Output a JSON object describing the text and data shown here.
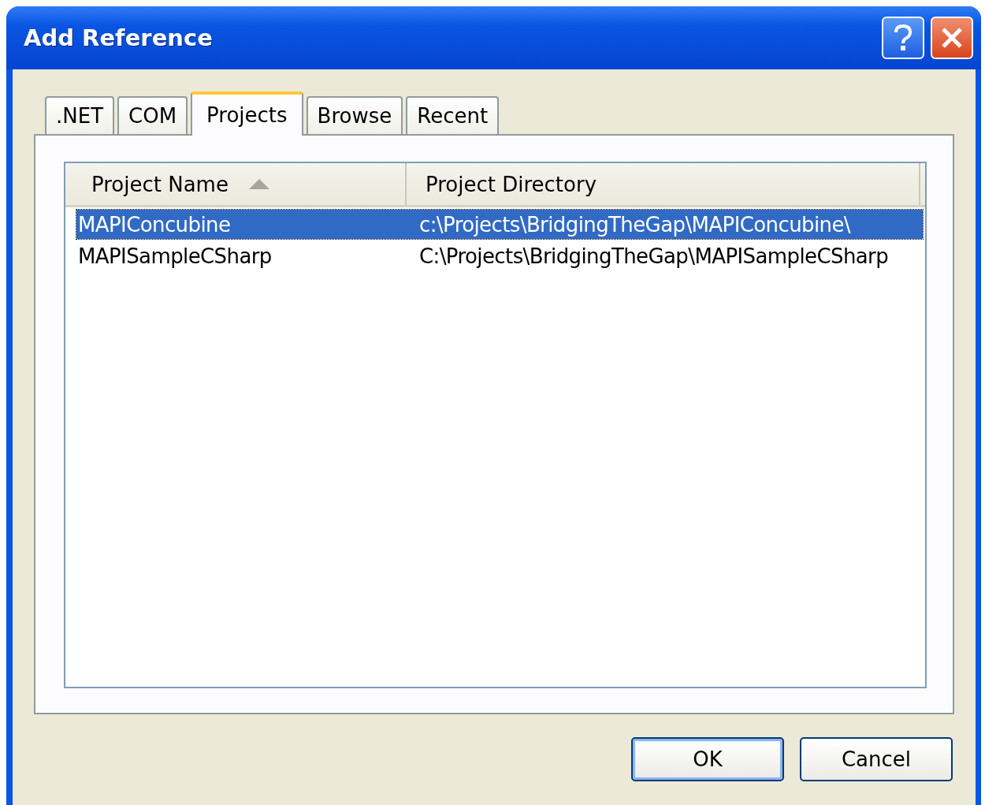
{
  "window": {
    "title": "Add Reference"
  },
  "tabs": [
    {
      "label": ".NET",
      "selected": false
    },
    {
      "label": "COM",
      "selected": false
    },
    {
      "label": "Projects",
      "selected": true
    },
    {
      "label": "Browse",
      "selected": false
    },
    {
      "label": "Recent",
      "selected": false
    }
  ],
  "table": {
    "columns": [
      {
        "label": "Project Name",
        "sorted": true
      },
      {
        "label": "Project Directory",
        "sorted": false
      }
    ],
    "rows": [
      {
        "cells": [
          "MAPIConcubine",
          "c:\\Projects\\BridgingTheGap\\MAPIConcubine\\"
        ],
        "selected": true
      },
      {
        "cells": [
          "MAPISampleCSharp",
          "C:\\Projects\\BridgingTheGap\\MAPISampleCSharp"
        ],
        "selected": false
      }
    ]
  },
  "buttons": [
    {
      "label": "OK",
      "default": true
    },
    {
      "label": "Cancel",
      "default": false
    }
  ]
}
